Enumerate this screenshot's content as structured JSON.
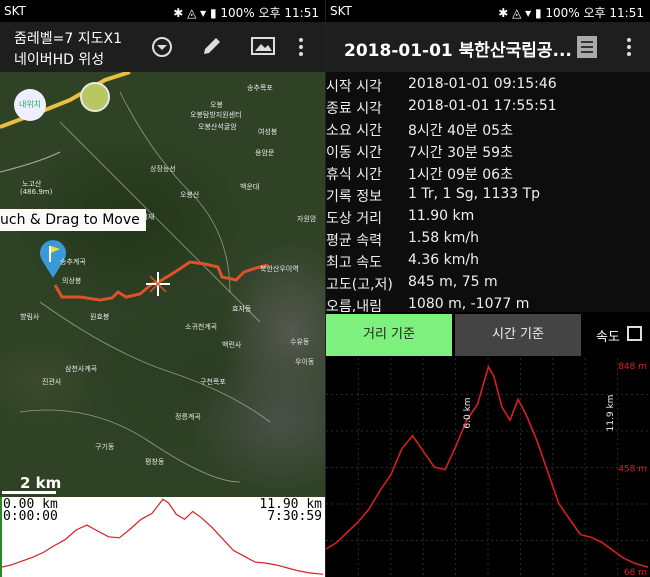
{
  "left": {
    "status": {
      "carrier": "SKT",
      "battery": "100%",
      "time": "오후 11:51"
    },
    "appbar": {
      "line1": "줌레벨=7 지도X1",
      "line2": "네이버HD 위성"
    },
    "map": {
      "toast": "uch & Drag to Move",
      "scale": "2 km",
      "badges": [
        "내위치"
      ],
      "labels": [
        "송추폭포",
        "오봉",
        "오봉탐방지원센터",
        "오봉산석굴암",
        "여성봉",
        "노고산",
        "(486.9m)",
        "상장능선",
        "용암문",
        "기억재",
        "오봉산",
        "백운대",
        "자원암",
        "송추계곡",
        "진관사",
        "삼천사계곡",
        "구천폭포",
        "정릉계곡",
        "평창동",
        "구기동",
        "수유동",
        "북한산우이역",
        "우이동",
        "향림사",
        "의상봉",
        "소귀천계곡",
        "백련사",
        "효자동",
        "원효봉"
      ]
    },
    "profile": {
      "distance": "0.00 km",
      "time": "0:00:00",
      "total_distance": "11.90 km",
      "total_time": "7:30:59"
    }
  },
  "right": {
    "status": {
      "carrier": "SKT",
      "battery": "100%",
      "time": "오후 11:51"
    },
    "title": "2018-01-01 북한산국립공...",
    "info": [
      {
        "label": "시작 시각",
        "value": "2018-01-01 09:15:46"
      },
      {
        "label": "종료 시각",
        "value": "2018-01-01 17:55:51"
      },
      {
        "label": "소요 시간",
        "value": "8시간 40분 05초"
      },
      {
        "label": "이동 시간",
        "value": "7시간 30분 59초"
      },
      {
        "label": "휴식 시간",
        "value": "1시간 09분 06초"
      },
      {
        "label": "기록 정보",
        "value": "1 Tr, 1 Sg, 1133 Tp"
      },
      {
        "label": "도상 거리",
        "value": "11.90 km"
      },
      {
        "label": "평균 속력",
        "value": "1.58 km/h"
      },
      {
        "label": "최고 속도",
        "value": "4.36 km/h"
      },
      {
        "label": "고도(고,저)",
        "value": "845 m, 75 m"
      },
      {
        "label": "오름,내림",
        "value": "1080 m, -1077 m"
      }
    ],
    "buttons": {
      "distance": "거리 기준",
      "time": "시간 기준",
      "speed_label": "속도"
    },
    "colors": {
      "accent": "#7ef07e",
      "line": "#d62020",
      "route": "#e0502a"
    }
  },
  "chart_data": {
    "type": "line",
    "x_unit": "km",
    "x": [
      0,
      0.4,
      0.8,
      1.2,
      1.6,
      2.0,
      2.4,
      2.8,
      3.2,
      3.6,
      4.0,
      4.4,
      4.8,
      5.2,
      5.6,
      6.0,
      6.2,
      6.5,
      6.8,
      7.1,
      7.4,
      7.8,
      8.2,
      8.6,
      9.0,
      9.4,
      9.8,
      10.2,
      10.6,
      11.0,
      11.4,
      11.9
    ],
    "y": [
      145,
      170,
      210,
      250,
      300,
      370,
      430,
      530,
      580,
      520,
      460,
      450,
      540,
      640,
      700,
      845,
      810,
      690,
      640,
      720,
      660,
      560,
      440,
      320,
      260,
      200,
      190,
      170,
      140,
      110,
      90,
      75
    ],
    "xticks": [
      "0.0 km",
      "6.0 km",
      "11.9 km"
    ],
    "yticks": [
      "848 m",
      "458 m",
      "68 m"
    ],
    "ylim": [
      68,
      848
    ],
    "grid": true
  }
}
